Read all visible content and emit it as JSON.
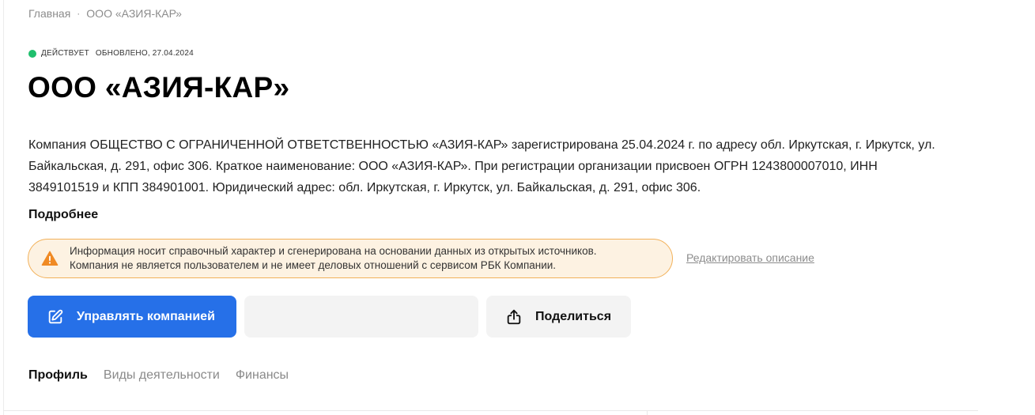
{
  "breadcrumb": {
    "home": "Главная",
    "separator": "·",
    "current": "ООО «АЗИЯ-КАР»"
  },
  "status": {
    "label": "ДЕЙСТВУЕТ",
    "updated": "ОБНОВЛЕНО, 27.04.2024",
    "color": "#1fbf6d"
  },
  "company": {
    "title": "ООО «АЗИЯ-КАР»",
    "description": "Компания ОБЩЕСТВО С ОГРАНИЧЕННОЙ ОТВЕТСТВЕННОСТЬЮ «АЗИЯ-КАР» зарегистрирована 25.04.2024 г. по адресу обл. Иркутская, г. Иркутск, ул. Байкальская, д. 291, офис 306. Краткое наименование: ООО «АЗИЯ-КАР». При регистрации организации присвоен ОГРН 1243800007010, ИНН 3849101519 и КПП 384901001. Юридический адрес: обл. Иркутская, г. Иркутск, ул. Байкальская, д. 291, офис 306.",
    "more_label": "Подробнее"
  },
  "notice": {
    "icon": "warning-icon",
    "line1": "Информация носит справочный характер и сгенерирована на основании данных из открытых источников.",
    "line2": "Компания не является пользователем и не имеет деловых отношений с сервисом РБК Компании.",
    "border_color": "#f2b15a",
    "background": "#fdf2e2"
  },
  "edit_link": "Редактировать описание",
  "actions": {
    "manage": {
      "label": "Управлять компанией",
      "icon": "edit-icon",
      "color": "#2670e8"
    },
    "share": {
      "label": "Поделиться",
      "icon": "share-icon"
    }
  },
  "tabs": [
    {
      "label": "Профиль",
      "active": true
    },
    {
      "label": "Виды деятельности",
      "active": false
    },
    {
      "label": "Финансы",
      "active": false
    }
  ]
}
